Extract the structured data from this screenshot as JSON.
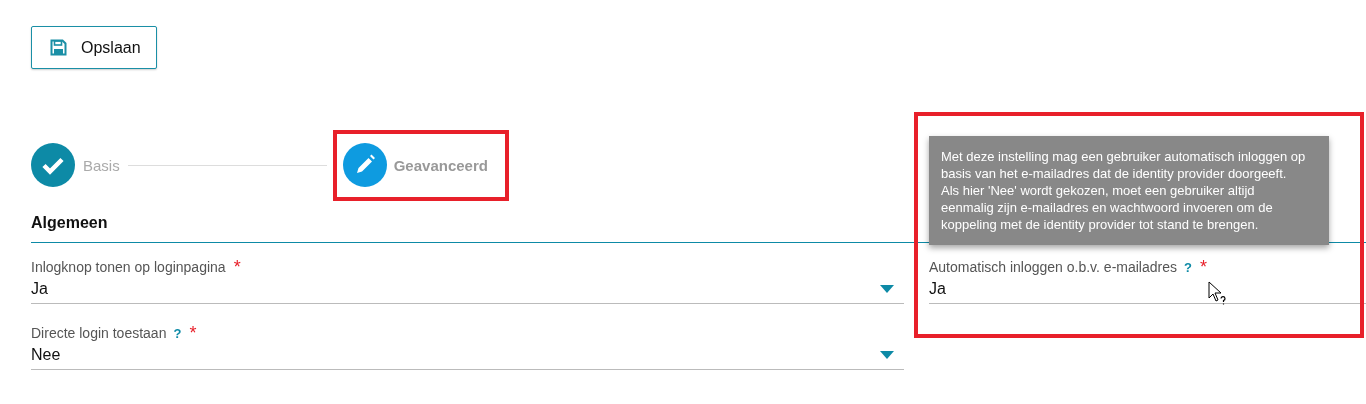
{
  "save_button": {
    "label": "Opslaan"
  },
  "steps": [
    {
      "label": "Basis",
      "completed": true
    },
    {
      "label": "Geavanceerd",
      "completed": false
    }
  ],
  "section": {
    "title": "Algemeen"
  },
  "fields": [
    {
      "label": "Inlogknop tonen op loginpagina",
      "value": "Ja",
      "required_mark": "*",
      "dropdown": true
    },
    {
      "label": "Automatisch inloggen o.b.v. e-mailadres",
      "value": "Ja",
      "help_icon": "?",
      "required_mark": "*",
      "dropdown": false
    },
    {
      "label": "Directe login toestaan",
      "value": "Nee",
      "help_icon": "?",
      "required_mark": "*",
      "dropdown": true
    }
  ],
  "tooltip": {
    "text": "Met deze instelling mag een gebruiker automatisch inloggen op basis van het e-mailadres dat de identity provider doorgeeft. Als hier 'Nee' wordt gekozen, moet een gebruiker altijd eenmalig zijn e-mailadres en wachtwoord invoeren om de koppeling met de identity provider tot stand te brengen."
  }
}
